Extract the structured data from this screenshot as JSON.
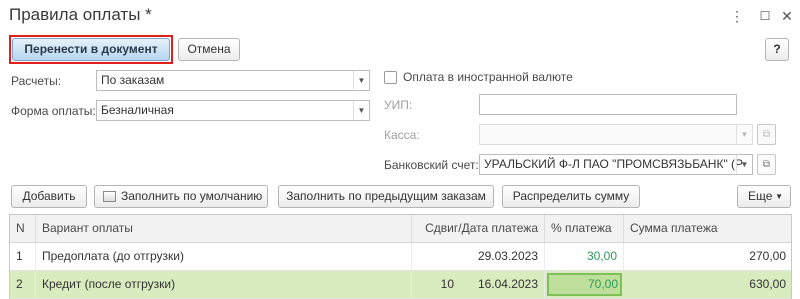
{
  "window": {
    "title": "Правила оплаты *",
    "more_icon": "⋮",
    "maximize_icon": "☐",
    "close_icon": "✕"
  },
  "toolbar": {
    "transfer_label": "Перенести в документ",
    "cancel_label": "Отмена",
    "help_label": "?"
  },
  "form": {
    "calculations_label": "Расчеты:",
    "calculations_value": "По заказам",
    "payment_form_label": "Форма оплаты:",
    "payment_form_value": "Безналичная",
    "foreign_currency_label": "Оплата в иностранной валюте",
    "uip_label": "УИП:",
    "uip_value": "",
    "cash_label": "Касса:",
    "cash_value": "",
    "bank_account_label": "Банковский счет:",
    "bank_account_value": "УРАЛЬСКИЙ Ф-Л ПАО \"ПРОМСВЯЗЬБАНК\" (Р"
  },
  "table_toolbar": {
    "add_label": "Добавить",
    "fill_default_label": "Заполнить по умолчанию",
    "fill_previous_label": "Заполнить по предыдущим заказам",
    "distribute_label": "Распределить сумму",
    "more_label": "Еще"
  },
  "table": {
    "columns": [
      "N",
      "Вариант оплаты",
      "Сдвиг/Дата платежа",
      "% платежа",
      "Сумма платежа"
    ],
    "rows": [
      {
        "n": "1",
        "variant": "Предоплата (до отгрузки)",
        "shift": "",
        "date": "29.03.2023",
        "percent": "30,00",
        "sum": "270,00"
      },
      {
        "n": "2",
        "variant": "Кредит (после отгрузки)",
        "shift": "10",
        "date": "16.04.2023",
        "percent": "70,00",
        "sum": "630,00"
      }
    ]
  },
  "colors": {
    "selected_row": "#d9ecbf",
    "highlight_frame": "#e0201a",
    "percent_green": "#2e9a5a"
  }
}
